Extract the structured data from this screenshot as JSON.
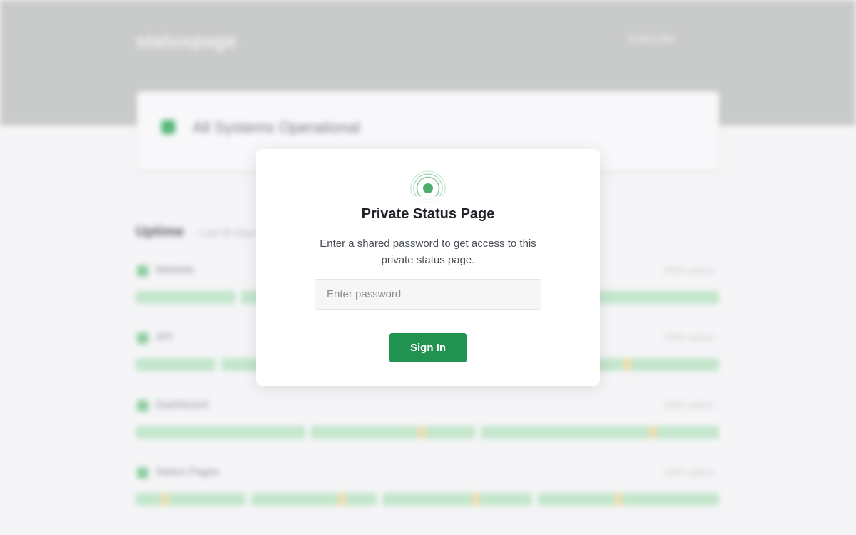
{
  "background": {
    "logo": "statuspage",
    "subscribe_label": "Subscribe",
    "banner_text": "All Systems Operational",
    "section_title": "Uptime",
    "section_sub": "Last 90 days",
    "components": [
      {
        "name": "Website",
        "uptime": "100% uptime"
      },
      {
        "name": "API",
        "uptime": "100% uptime"
      },
      {
        "name": "Dashboard",
        "uptime": "100% uptime"
      },
      {
        "name": "Status Pages",
        "uptime": "100% uptime"
      }
    ]
  },
  "modal": {
    "title": "Private Status Page",
    "description": "Enter a shared password to get access to this private status page.",
    "password_placeholder": "Enter password",
    "sign_in_label": "Sign In"
  },
  "colors": {
    "accent": "#21924f",
    "status_green": "#4cae6c"
  },
  "icons": {
    "status": "status-signal-icon"
  }
}
